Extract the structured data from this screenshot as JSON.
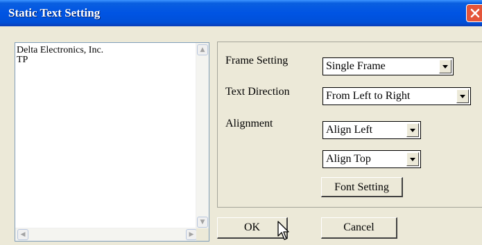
{
  "window": {
    "title": "Static Text Setting"
  },
  "text_area": {
    "content": "Delta Electronics, Inc.\nTP"
  },
  "frame_setting": {
    "label": "Frame Setting",
    "value": "Single Frame"
  },
  "text_direction": {
    "label": "Text Direction",
    "value": "From Left to Right"
  },
  "alignment": {
    "label": "Alignment",
    "horizontal": "Align Left",
    "vertical": "Align Top"
  },
  "buttons": {
    "font_setting": "Font Setting",
    "ok": "OK",
    "cancel": "Cancel"
  },
  "icons": {
    "close": "close-icon",
    "cursor": "mouse-pointer-icon"
  },
  "colors": {
    "titlebar": "#0054e3",
    "close_button": "#e4553a",
    "dialog_bg": "#ece9d8"
  }
}
